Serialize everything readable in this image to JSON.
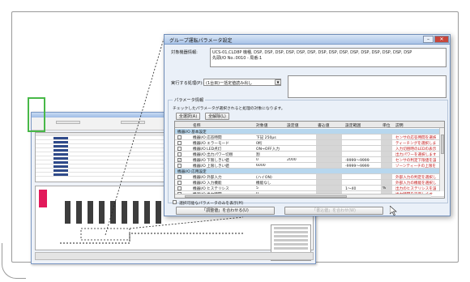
{
  "dialog": {
    "title": "グループ運転パラメータ設定",
    "target_label": "対象機器情報:",
    "target_value_1": "UCS-01,CLD8P 機種, DSP, DSP, DSP, DSP, DSP, DSP, DSP, DSP, DSP, DSP, DSP, DSP, DSP, DSP, DSP",
    "target_value_2": "先頭I/O No.:0010 - 局番:1",
    "process_label": "実行する処理(P):",
    "process_value": "(1台目)一括定値読み出し",
    "param_group_label": "パラメータ情報",
    "param_hint": "チェックしたパラメータが選択されると処理の対象になります。",
    "select_all_button": "全選択(A)",
    "deselect_all_button": "全解除(L)",
    "show_only_selectable": "選択可能なパラメータのみを表示(H)",
    "apply_button": "「調整値」を合わせる(U)",
    "execute_button": "「書込値」を合わせ(W)"
  },
  "table": {
    "headers": [
      "名称",
      "対象値",
      "設定値",
      "書込値",
      "設定範囲",
      "単位",
      "説明"
    ],
    "rows": [
      {
        "type": "cat",
        "name": "機器I/O 基本設定"
      },
      {
        "type": "row",
        "checked": false,
        "name": "機器I/O 応答時間",
        "target": "下記  250μs",
        "setting": "",
        "write": "",
        "range": "",
        "unit": "",
        "desc": "センサの応答時間を選択します"
      },
      {
        "type": "row",
        "checked": false,
        "name": "機器I/O エラーモード",
        "target": "0桁",
        "setting": "",
        "write": "",
        "range": "",
        "unit": "",
        "desc": "ティーチングを選択します"
      },
      {
        "type": "row",
        "checked": false,
        "name": "機器I/O LED点灯",
        "target": "ON→OFF入力",
        "setting": "",
        "write": "",
        "range": "",
        "unit": "",
        "desc": "入力切替時のLEDの表示"
      },
      {
        "type": "row",
        "checked": false,
        "name": "機器I/O 出力パワー切替",
        "target": "割",
        "setting": "",
        "write": "",
        "range": "",
        "unit": "",
        "desc": "出力パワーを選択します"
      },
      {
        "type": "row",
        "checked": true,
        "name": "機器I/O 下限しきい値",
        "target": "0",
        "setting": "2000",
        "write": "",
        "range": "-9999～9999",
        "unit": "",
        "desc": "センサの判定下限値を設定"
      },
      {
        "type": "row",
        "checked": false,
        "name": "機器I/O 上限しきい値",
        "target": "6000",
        "setting": "",
        "write": "",
        "range": "-9999～9999",
        "unit": "",
        "desc": "ゾーンティーチの上限を設定"
      },
      {
        "type": "cat",
        "name": "機器I/O 応用設定"
      },
      {
        "type": "row",
        "checked": false,
        "name": "機器I/O 外部入力",
        "target": "(ハイON)",
        "setting": "",
        "write": "",
        "range": "",
        "unit": "",
        "desc": "外部入力の判定を選択します"
      },
      {
        "type": "row",
        "checked": false,
        "name": "機器I/O 入力機能",
        "target": "機能なし",
        "setting": "",
        "write": "",
        "range": "",
        "unit": "",
        "desc": "外部入力の機能を選択します"
      },
      {
        "type": "row",
        "checked": false,
        "name": "機器I/O ヒステリシス",
        "target": "5",
        "setting": "",
        "write": "",
        "range": "1～40",
        "unit": "%",
        "desc": "出力のヒステリシスを設定"
      },
      {
        "type": "row",
        "checked": false,
        "name": "機器I/O 出力時間",
        "target": "0",
        "setting": "",
        "write": "",
        "range": "",
        "unit": "",
        "desc": "出力時間を設定します"
      }
    ]
  },
  "colors": {
    "category_row": "#b7d7ee",
    "description_text": "#c21818",
    "selection_highlight": "#48b848",
    "selected_module": "#e2195a"
  }
}
